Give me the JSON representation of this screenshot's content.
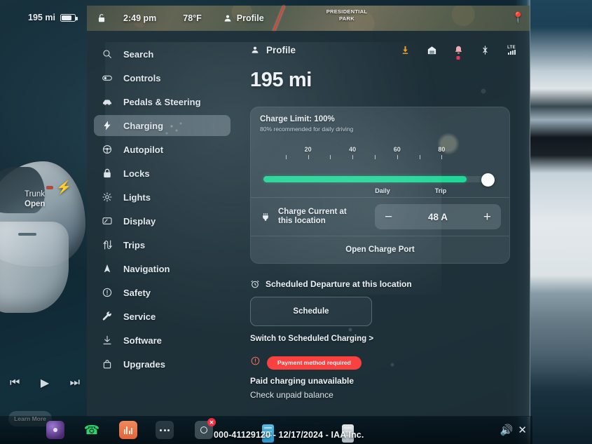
{
  "vehicle_status": {
    "range_top_left": "195 mi",
    "battery_icon": "battery-icon",
    "trunk_label": "Trunk",
    "trunk_state": "Open",
    "learn_more_label": "Learn More",
    "charge_port_icon": "lightning-bolt-icon"
  },
  "media_controls": {
    "previous_icon": "previous-track-icon",
    "play_icon": "play-icon",
    "next_icon": "next-track-icon"
  },
  "topbar": {
    "lock_icon": "unlocked-padlock-icon",
    "time": "2:49 pm",
    "temperature": "78°F",
    "profile_icon": "person-icon",
    "profile_label": "Profile"
  },
  "map": {
    "place_label": "PRESIDENTIAL PARK",
    "pin_icon": "map-pin-icon"
  },
  "sidebar": {
    "items": [
      {
        "label": "Search",
        "icon": "search-icon",
        "active": false
      },
      {
        "label": "Controls",
        "icon": "toggle-icon",
        "active": false
      },
      {
        "label": "Pedals & Steering",
        "icon": "car-icon",
        "active": false
      },
      {
        "label": "Charging",
        "icon": "lightning-bolt-icon",
        "active": true
      },
      {
        "label": "Autopilot",
        "icon": "steering-wheel-icon",
        "active": false
      },
      {
        "label": "Locks",
        "icon": "padlock-icon",
        "active": false
      },
      {
        "label": "Lights",
        "icon": "sun-icon",
        "active": false
      },
      {
        "label": "Display",
        "icon": "display-icon",
        "active": false
      },
      {
        "label": "Trips",
        "icon": "trips-icon",
        "active": false
      },
      {
        "label": "Navigation",
        "icon": "navigation-arrow-icon",
        "active": false
      },
      {
        "label": "Safety",
        "icon": "exclamation-circle-icon",
        "active": false
      },
      {
        "label": "Service",
        "icon": "wrench-icon",
        "active": false
      },
      {
        "label": "Software",
        "icon": "download-icon",
        "active": false
      },
      {
        "label": "Upgrades",
        "icon": "bag-icon",
        "active": false
      }
    ]
  },
  "content": {
    "profile_icon": "person-icon",
    "profile_label": "Profile",
    "header_icons": [
      {
        "name": "software-update-download-icon",
        "color": "#eda12a",
        "badge": false
      },
      {
        "name": "home-garage-icon",
        "color": "#e9eff2",
        "badge": false
      },
      {
        "name": "bell-icon",
        "color": "#e9eff2",
        "badge": true,
        "badge_color": "#f0335c"
      },
      {
        "name": "bluetooth-icon",
        "color": "#e9eff2",
        "badge": false
      },
      {
        "name": "lte-signal-icon",
        "color": "#e9eff2",
        "badge": false
      }
    ],
    "lte_label": "LTE",
    "range": "195 mi",
    "charge_card": {
      "limit_title": "Charge Limit: 100%",
      "limit_subtitle": "80% recommended for daily driving",
      "limit_percent": 100,
      "fill_percent": 88,
      "tick_labels": [
        "20",
        "40",
        "60",
        "80"
      ],
      "mode_labels": {
        "daily": "Daily",
        "trip": "Trip"
      },
      "fill_color": "#1fd895",
      "knob_color": "#fdfefe",
      "current_label_line1": "Charge Current at",
      "current_label_line2": "this location",
      "current_icon": "plug-icon",
      "minus_label": "−",
      "plus_label": "+",
      "current_value": "48 A",
      "open_charge_port_label": "Open Charge Port"
    },
    "scheduled": {
      "icon": "alarm-clock-icon",
      "heading": "Scheduled Departure at this location",
      "button_label": "Schedule",
      "switch_link": "Switch to Scheduled Charging >"
    },
    "payment": {
      "warn_icon": "exclamation-circle-icon",
      "pill_label": "Payment method required",
      "pill_color": "#f9413f",
      "line1": "Paid charging unavailable",
      "line2": "Check unpaid balance"
    }
  },
  "dock": {
    "apps": [
      {
        "name": "voice-assistant-icon"
      },
      {
        "name": "phone-icon"
      },
      {
        "name": "media-player-icon"
      },
      {
        "name": "more-apps-icon"
      },
      {
        "name": "camera-disabled-icon",
        "badge": "✕"
      }
    ],
    "volume_icon": "speaker-icon",
    "close_icon": "close-icon"
  },
  "watermark": {
    "text": "000-41129120 - 12/17/2024 - IAA Inc."
  }
}
